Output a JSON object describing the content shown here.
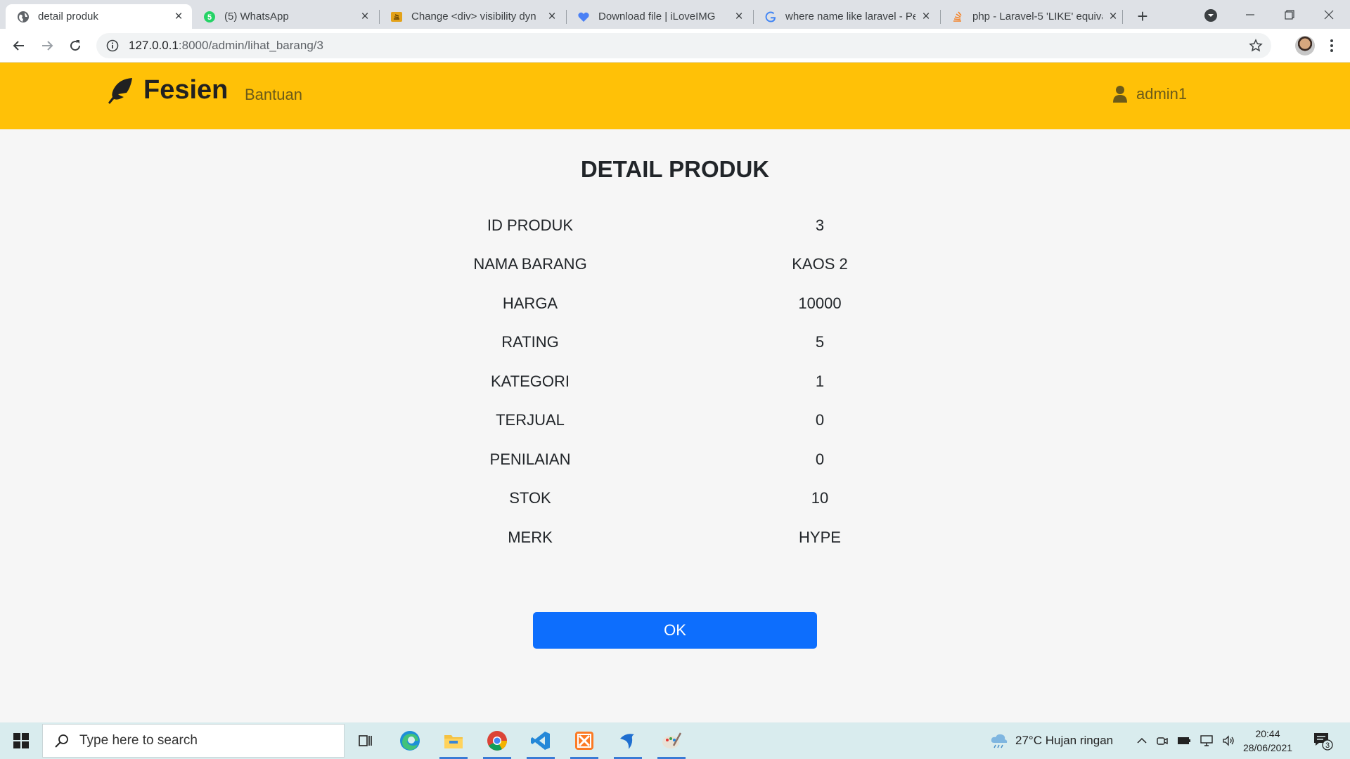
{
  "browser": {
    "tabs": [
      {
        "title": "detail produk",
        "active": true,
        "icon": "globe-icon"
      },
      {
        "title": "(5) WhatsApp",
        "active": false,
        "icon": "whatsapp-icon",
        "badge": "5"
      },
      {
        "title": "Change <div> visibility dyn",
        "active": false,
        "icon": "stackoverflow-icon"
      },
      {
        "title": "Download file | iLoveIMG",
        "active": false,
        "icon": "iloveimg-heart-icon"
      },
      {
        "title": "where name like laravel - Pe",
        "active": false,
        "icon": "google-icon"
      },
      {
        "title": "php - Laravel-5 'LIKE' equiva",
        "active": false,
        "icon": "stackoverflow-icon"
      }
    ],
    "url": "127.0.0.1:8000/admin/lihat_barang/3",
    "url_host": "127.0.0.1",
    "url_rest": ":8000/admin/lihat_barang/3"
  },
  "navbar": {
    "brand": "Fesien",
    "link": "Bantuan",
    "user": "admin1",
    "bg_color": "#ffc107"
  },
  "page": {
    "title": "DETAIL PRODUK",
    "details": [
      {
        "label": "ID PRODUK",
        "value": "3"
      },
      {
        "label": "NAMA BARANG",
        "value": "KAOS 2"
      },
      {
        "label": "HARGA",
        "value": "10000"
      },
      {
        "label": "RATING",
        "value": "5"
      },
      {
        "label": "KATEGORI",
        "value": "1"
      },
      {
        "label": "TERJUAL",
        "value": "0"
      },
      {
        "label": "PENILAIAN",
        "value": "0"
      },
      {
        "label": "STOK",
        "value": "10"
      },
      {
        "label": "MERK",
        "value": "HYPE"
      }
    ],
    "ok_label": "OK",
    "ok_color": "#0d6efd"
  },
  "taskbar": {
    "search_placeholder": "Type here to search",
    "weather": "27°C  Hujan ringan",
    "time": "20:44",
    "date": "28/06/2021",
    "notification_count": "3",
    "apps": [
      "task-view-icon",
      "edge-icon",
      "file-explorer-icon",
      "chrome-icon",
      "vscode-icon",
      "xampp-icon",
      "dolphin-icon",
      "paint-icon"
    ]
  }
}
